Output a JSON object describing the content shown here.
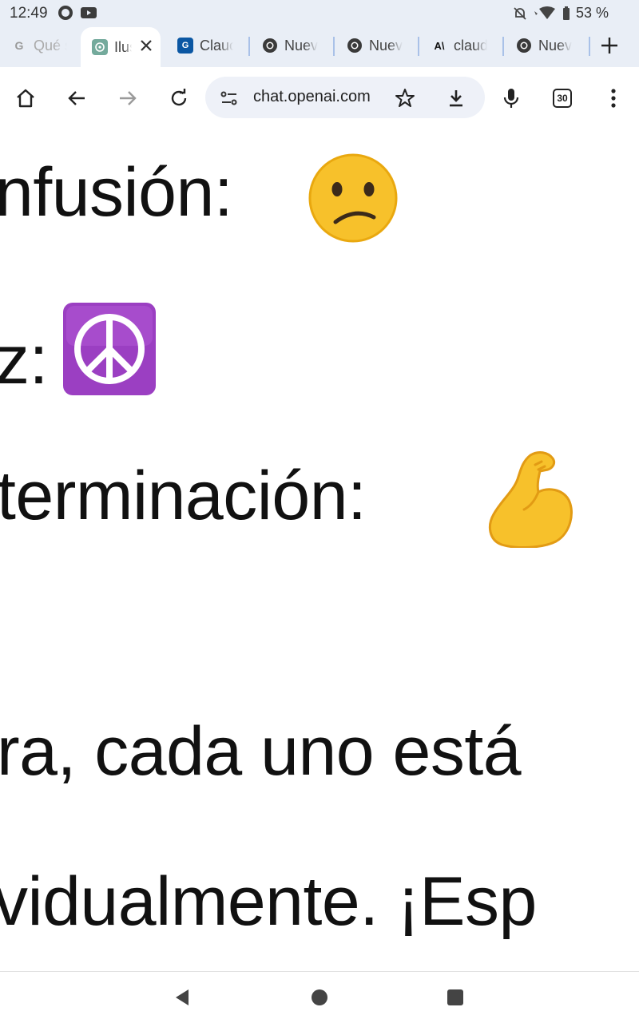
{
  "status_bar": {
    "time": "12:49",
    "battery_percent": "53 %",
    "icons": [
      "whatsapp-icon",
      "youtube-icon",
      "bell-off-icon",
      "wifi-icon",
      "battery-icon"
    ]
  },
  "tabs": [
    {
      "title": "Qué s",
      "favicon": "google-icon",
      "active": false
    },
    {
      "title": "Ilus",
      "favicon": "chatgpt-icon",
      "active": true
    },
    {
      "title": "Clauc",
      "favicon": "claude-site-icon",
      "active": false
    },
    {
      "title": "Nuev",
      "favicon": "chrome-icon",
      "active": false
    },
    {
      "title": "Nuev",
      "favicon": "chrome-icon",
      "active": false
    },
    {
      "title": "claud",
      "favicon": "anthropic-icon",
      "active": false
    },
    {
      "title": "Nuev",
      "favicon": "chrome-icon",
      "active": false
    }
  ],
  "toolbar": {
    "url": "chat.openai.com",
    "tab_count": "30"
  },
  "content": {
    "line1": "nfusión:",
    "line2": "z:",
    "line3": "terminación:",
    "line4": "ra, cada uno está",
    "line5": "vidualmente. ¡Esp"
  },
  "colors": {
    "chrome_bg": "#e9eef6",
    "omnibox_bg": "#eef1f8",
    "tab_separator": "#a9c1e8"
  }
}
